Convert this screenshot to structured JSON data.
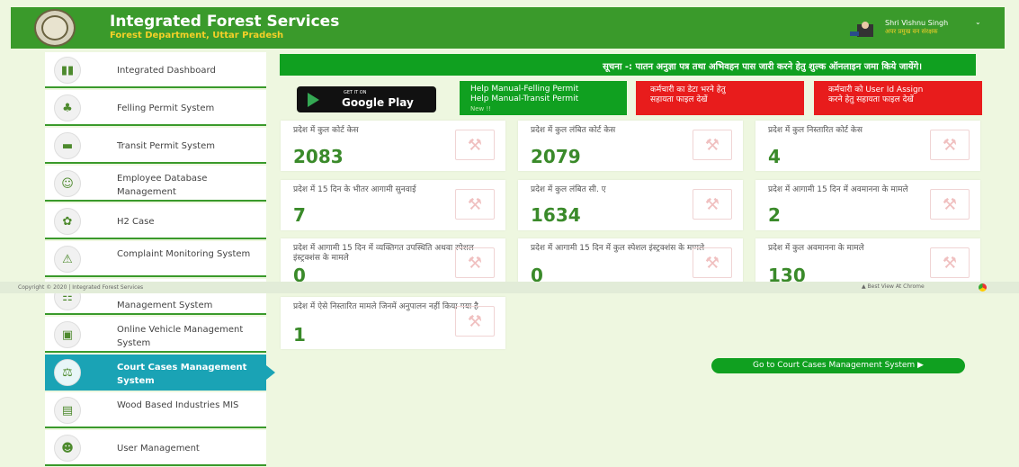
{
  "header": {
    "title": "Integrated Forest Services",
    "subtitle": "Forest Department, Uttar Pradesh",
    "user_name": "Shri Vishnu Singh",
    "user_role": "अपर प्रमुख वन संरक्षक"
  },
  "sidebar": {
    "items": [
      {
        "label": "Integrated Dashboard",
        "icon": "dashboard-icon"
      },
      {
        "label": "Felling Permit System",
        "icon": "tree-icon"
      },
      {
        "label": "Transit Permit System",
        "icon": "truck-icon"
      },
      {
        "label": "Employee Database Management",
        "icon": "employees-icon"
      },
      {
        "label": "H2 Case",
        "icon": "h2-case-icon"
      },
      {
        "label": "Complaint Monitoring System",
        "icon": "complaint-icon"
      },
      {
        "label": "Management System",
        "icon": "management-icon"
      },
      {
        "label": "Online Vehicle Management System",
        "icon": "vehicle-icon"
      },
      {
        "label": "Court Cases Management System",
        "icon": "court-icon",
        "active": true
      },
      {
        "label": "Wood Based Industries MIS",
        "icon": "industry-icon"
      },
      {
        "label": "User Management",
        "icon": "users-icon"
      }
    ]
  },
  "notice": "सूचना -: पातन अनुज्ञा पत्र तथा अभिवहन पास जारी करने हेतु शुल्क ऑनलाइन जमा किये जायेंगे।",
  "google_play": {
    "small": "GET IT ON",
    "big": "Google Play"
  },
  "help": {
    "felling": "Help Manual-Felling Permit",
    "transit": "Help Manual-Transit Permit",
    "new": "New !!"
  },
  "red_buttons": [
    {
      "line1": "कर्मचारी का डेटा भरने हेतु",
      "line2": "सहायता फाइल देखें"
    },
    {
      "line1": "कर्मचारी को User Id Assign",
      "line2": "करने हेतु सहायता फाइल देखें"
    }
  ],
  "stats": [
    {
      "title": "प्रदेश में कुल कोर्ट केस",
      "value": "2083"
    },
    {
      "title": "प्रदेश में कुल लंबित कोर्ट केस",
      "value": "2079"
    },
    {
      "title": "प्रदेश में कुल निस्तारित कोर्ट केस",
      "value": "4"
    },
    {
      "title": "प्रदेश में 15 दिन के भीतर आगामी सुनवाई",
      "value": "7"
    },
    {
      "title": "प्रदेश में कुल लंबित सी. ए",
      "value": "1634"
    },
    {
      "title": "प्रदेश में आगामी 15 दिन में अवमानना के मामले",
      "value": "2"
    },
    {
      "title": "प्रदेश में आगामी 15 दिन में व्यक्तिगत उपस्थिति अथवा स्पेशल इंस्ट्रक्शंस के मामले",
      "value": "0"
    },
    {
      "title": "प्रदेश में आगामी 15 दिन में कुल स्पेशल इंस्ट्रक्शंस के मामले",
      "value": "0"
    },
    {
      "title": "प्रदेश में कुल अवमानना के मामले",
      "value": "130"
    },
    {
      "title": "प्रदेश में ऐसे निस्तारित मामले जिनमें अनुपालन नहीं किया गया है",
      "value": "1"
    }
  ],
  "footer": {
    "copyright": "Copyright © 2020 | Integrated Forest Services",
    "best_view": "Best View At Chrome"
  },
  "goto_button": "Go to Court Cases Management System ▶"
}
